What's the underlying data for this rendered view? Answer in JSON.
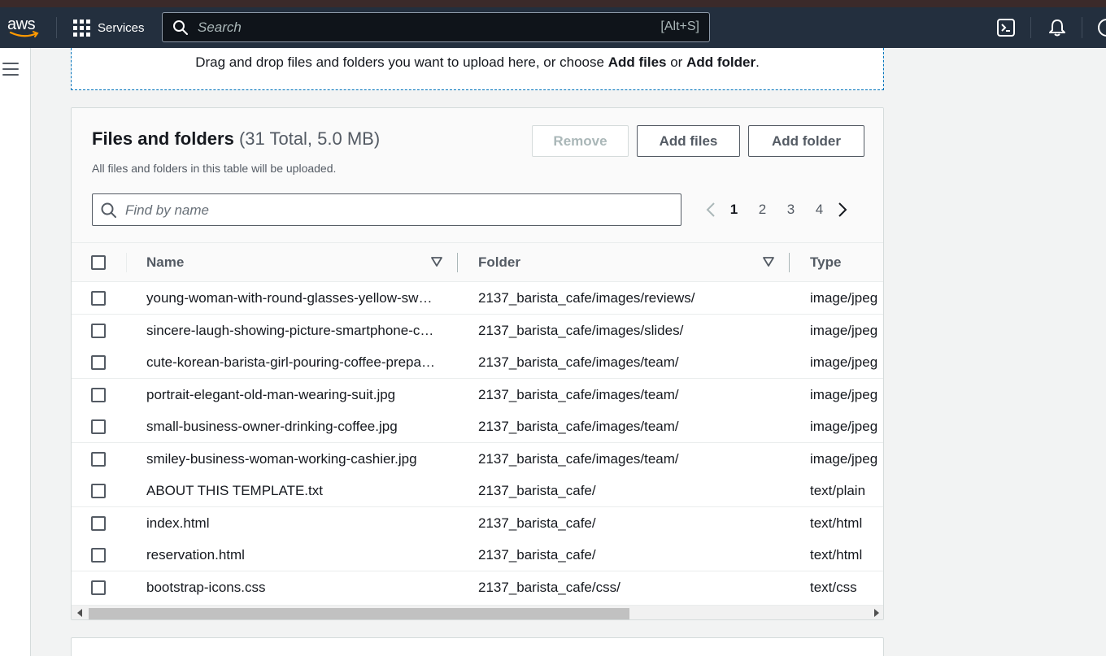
{
  "topnav": {
    "logo_text": "aws",
    "services_label": "Services",
    "search_placeholder": "Search",
    "search_shortcut": "[Alt+S]"
  },
  "dropzone": {
    "text_before": "Drag and drop files and folders you want to upload here, or choose ",
    "add_files": "Add files",
    "text_or": " or ",
    "add_folder": "Add folder",
    "text_after": "."
  },
  "files_panel": {
    "title": "Files and folders",
    "count": "(31 Total, 5.0 MB)",
    "description": "All files and folders in this table will be uploaded.",
    "remove_label": "Remove",
    "add_files_label": "Add files",
    "add_folder_label": "Add folder",
    "find_placeholder": "Find by name",
    "pages": [
      "1",
      "2",
      "3",
      "4"
    ],
    "current_page": "1",
    "columns": {
      "name": "Name",
      "folder": "Folder",
      "type": "Type"
    },
    "rows": [
      {
        "name": "young-woman-with-round-glasses-yellow-sweater.jpg",
        "folder": "2137_barista_cafe/images/reviews/",
        "type": "image/jpeg"
      },
      {
        "name": "sincere-laugh-showing-picture-smartphone-casual-wear.jpg",
        "folder": "2137_barista_cafe/images/slides/",
        "type": "image/jpeg"
      },
      {
        "name": "cute-korean-barista-girl-pouring-coffee-prepare-filter.jpg",
        "folder": "2137_barista_cafe/images/team/",
        "type": "image/jpeg"
      },
      {
        "name": "portrait-elegant-old-man-wearing-suit.jpg",
        "folder": "2137_barista_cafe/images/team/",
        "type": "image/jpeg"
      },
      {
        "name": "small-business-owner-drinking-coffee.jpg",
        "folder": "2137_barista_cafe/images/team/",
        "type": "image/jpeg"
      },
      {
        "name": "smiley-business-woman-working-cashier.jpg",
        "folder": "2137_barista_cafe/images/team/",
        "type": "image/jpeg"
      },
      {
        "name": "ABOUT THIS TEMPLATE.txt",
        "folder": "2137_barista_cafe/",
        "type": "text/plain"
      },
      {
        "name": "index.html",
        "folder": "2137_barista_cafe/",
        "type": "text/html"
      },
      {
        "name": "reservation.html",
        "folder": "2137_barista_cafe/",
        "type": "text/html"
      },
      {
        "name": "bootstrap-icons.css",
        "folder": "2137_barista_cafe/css/",
        "type": "text/css"
      }
    ]
  },
  "colors": {
    "nav_bg": "#232f3e",
    "accent_dash": "#0073bb",
    "aws_orange": "#ff9900"
  },
  "icons": [
    "grid-icon",
    "search-icon",
    "cloudshell-icon",
    "bell-icon",
    "help-icon",
    "hamburger-icon",
    "chevron-left-icon",
    "chevron-right-icon",
    "sort-down-icon"
  ]
}
